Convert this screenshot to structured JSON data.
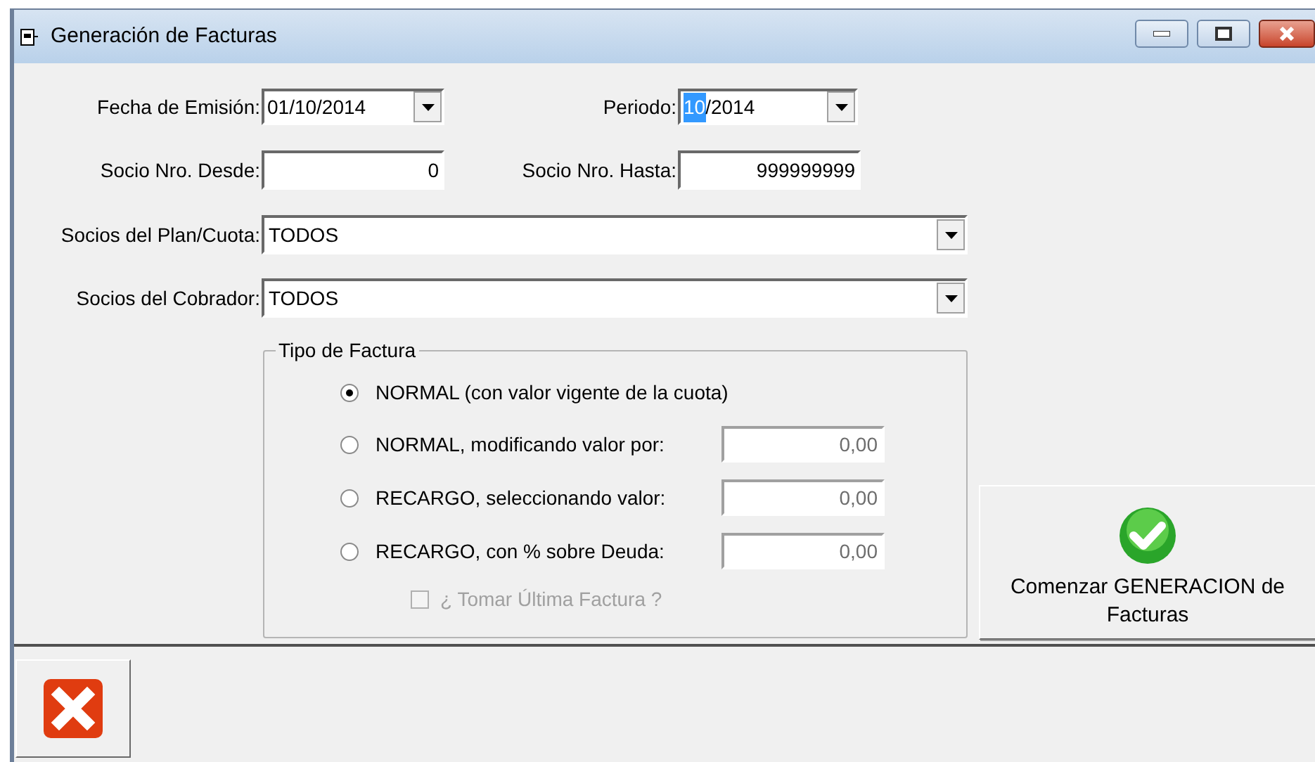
{
  "window": {
    "title": "Generación de Facturas"
  },
  "fecha_emision": {
    "label": "Fecha de Emisión:",
    "value": "01/10/2014"
  },
  "periodo": {
    "label": "Periodo:",
    "value_selected": "10",
    "value_rest": "/2014"
  },
  "socio_desde": {
    "label": "Socio Nro. Desde:",
    "value": "0"
  },
  "socio_hasta": {
    "label": "Socio Nro. Hasta:",
    "value": "999999999"
  },
  "plan_cuota": {
    "label": "Socios del Plan/Cuota:",
    "value": "TODOS"
  },
  "cobrador": {
    "label": "Socios del Cobrador:",
    "value": "TODOS"
  },
  "tipo_factura": {
    "title": "Tipo de Factura",
    "options": [
      {
        "label": "NORMAL (con valor vigente de la cuota)",
        "selected": true
      },
      {
        "label": "NORMAL, modificando valor por:",
        "selected": false,
        "value": "0,00"
      },
      {
        "label": "RECARGO, seleccionando valor:",
        "selected": false,
        "value": "0,00"
      },
      {
        "label": "RECARGO, con % sobre Deuda:",
        "selected": false,
        "value": "0,00"
      }
    ],
    "checkbox": {
      "label": "¿ Tomar Última Factura ?",
      "checked": false,
      "disabled": true
    }
  },
  "start_button": {
    "label": "Comenzar GENERACION de Facturas"
  }
}
